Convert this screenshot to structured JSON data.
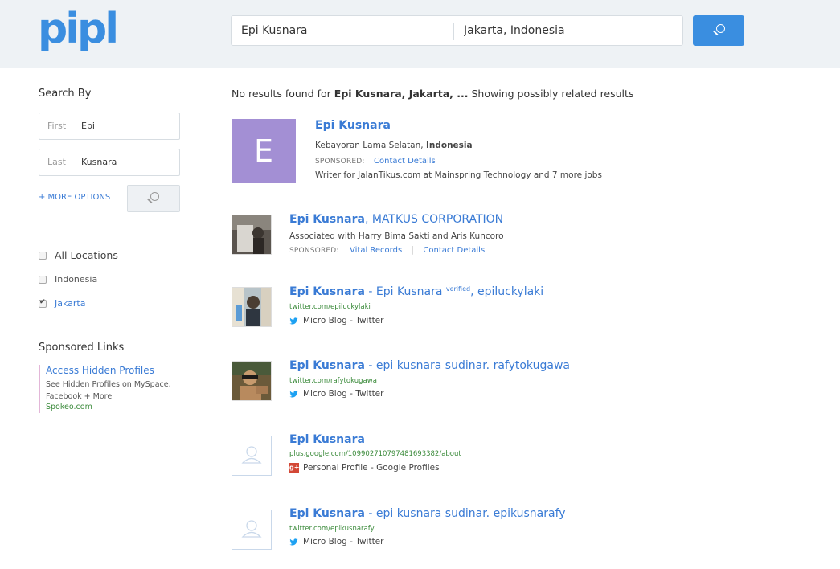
{
  "header": {
    "logo": "pipl",
    "search_name": "Epi Kusnara",
    "search_location": "Jakarta, Indonesia"
  },
  "sidebar": {
    "search_by_title": "Search By",
    "first_label": "First",
    "first_value": "Epi",
    "last_label": "Last",
    "last_value": "Kusnara",
    "more_options": "+ MORE OPTIONS",
    "locations": [
      {
        "label": "All Locations",
        "checked": false
      },
      {
        "label": "Indonesia",
        "checked": false
      },
      {
        "label": "Jakarta",
        "checked": true
      }
    ],
    "sponsored_title": "Sponsored Links",
    "sponsored": {
      "link": "Access Hidden Profiles",
      "desc": "See Hidden Profiles on MySpace, Facebook + More",
      "url": "Spokeo.com"
    }
  },
  "summary": {
    "prefix": "No results found for ",
    "query": "Epi Kusnara, Jakarta, ...",
    "suffix": " Showing possibly related results"
  },
  "results": [
    {
      "avatar_letter": "E",
      "name": "Epi Kusnara",
      "location_prefix": "Kebayoran Lama Selatan, ",
      "location_bold": "Indonesia",
      "sponsored_label": "SPONSORED:",
      "link1": "Contact Details",
      "desc": "Writer for JalanTikus.com at Mainspring Technology and 7 more jobs"
    },
    {
      "name": "Epi Kusnara",
      "name_suffix": ", MATKUS CORPORATION",
      "desc": "Associated with Harry Bima Sakti and Aris Kuncoro",
      "sponsored_label": "SPONSORED:",
      "link1": "Vital Records",
      "link2": "Contact Details"
    },
    {
      "name": "Epi Kusnara",
      "name_suffix": " - Epi Kusnara ",
      "verified": "verified",
      "name_suffix2": ", epiluckylaki",
      "url": "twitter.com/epiluckylaki",
      "source": "Micro Blog - Twitter"
    },
    {
      "name": "Epi Kusnara",
      "name_suffix": " - epi kusnara sudinar. rafytokugawa",
      "url": "twitter.com/rafytokugawa",
      "source": "Micro Blog - Twitter"
    },
    {
      "name": "Epi Kusnara",
      "url": "plus.google.com/109902710797481693382/about",
      "source": "Personal Profile - Google Profiles",
      "gplus_glyph": "g+"
    },
    {
      "name": "Epi Kusnara",
      "name_suffix": " - epi kusnara sudinar. epikusnarafy",
      "url": "twitter.com/epikusnarafy",
      "source": "Micro Blog - Twitter"
    }
  ],
  "colors": {
    "accent": "#3a8ee0",
    "link": "#3a7bd5",
    "url_green": "#3a8a3a",
    "avatar_purple": "#a38fd4"
  }
}
